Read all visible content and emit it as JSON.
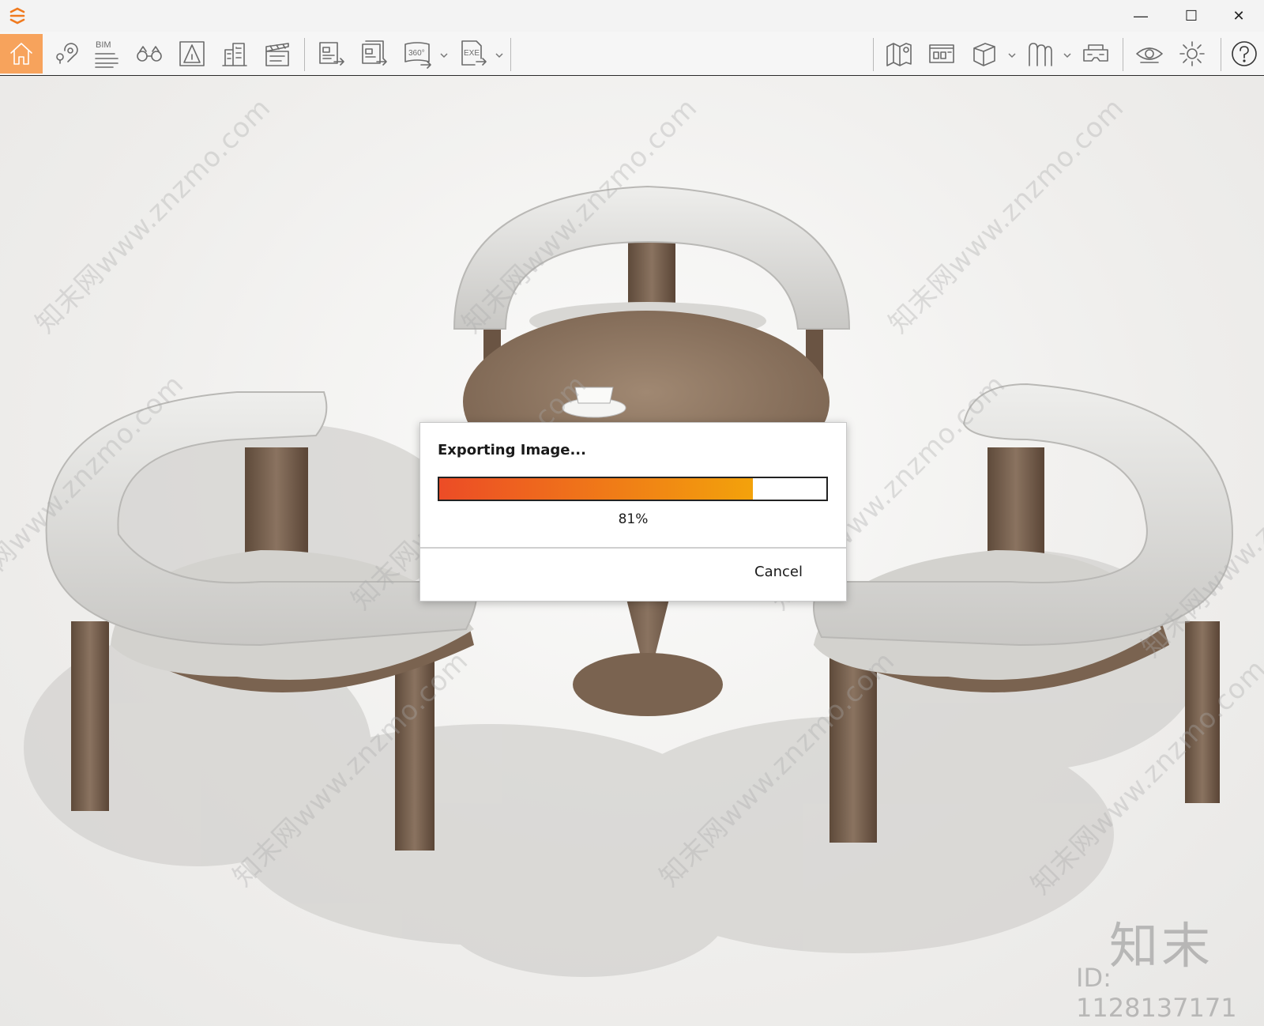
{
  "window": {
    "minimize_glyph": "—",
    "maximize_glyph": "☐",
    "close_glyph": "✕"
  },
  "toolbar": {
    "bim_label": "BIM",
    "accent_color": "#f7a35c",
    "items": [
      {
        "name": "home-icon",
        "active": true
      },
      {
        "name": "location-pin-icon"
      },
      {
        "name": "bim-icon"
      },
      {
        "name": "binoculars-icon"
      },
      {
        "name": "perspective-icon"
      },
      {
        "name": "buildings-icon"
      },
      {
        "name": "clapperboard-icon"
      },
      {
        "name": "export-image-icon"
      },
      {
        "name": "batch-export-icon"
      },
      {
        "name": "export-360-icon"
      },
      {
        "name": "export-exe-icon"
      },
      {
        "name": "map-icon"
      },
      {
        "name": "image-gallery-icon"
      },
      {
        "name": "cube-icon"
      },
      {
        "name": "asset-library-icon"
      },
      {
        "name": "vr-headset-icon"
      },
      {
        "name": "eye-icon"
      },
      {
        "name": "settings-icon"
      },
      {
        "name": "help-icon"
      }
    ],
    "export_360_label": "360°",
    "export_exe_label": "EXE"
  },
  "dialog": {
    "title": "Exporting Image...",
    "progress": 0.81,
    "progress_text": "81%",
    "cancel_label": "Cancel",
    "progress_colors": [
      "#ec4c26",
      "#f3a20b"
    ]
  },
  "watermark": {
    "text": "知末网www.znzmo.com",
    "brand_cn": "知末",
    "brand_id": "ID: 1128137171"
  }
}
